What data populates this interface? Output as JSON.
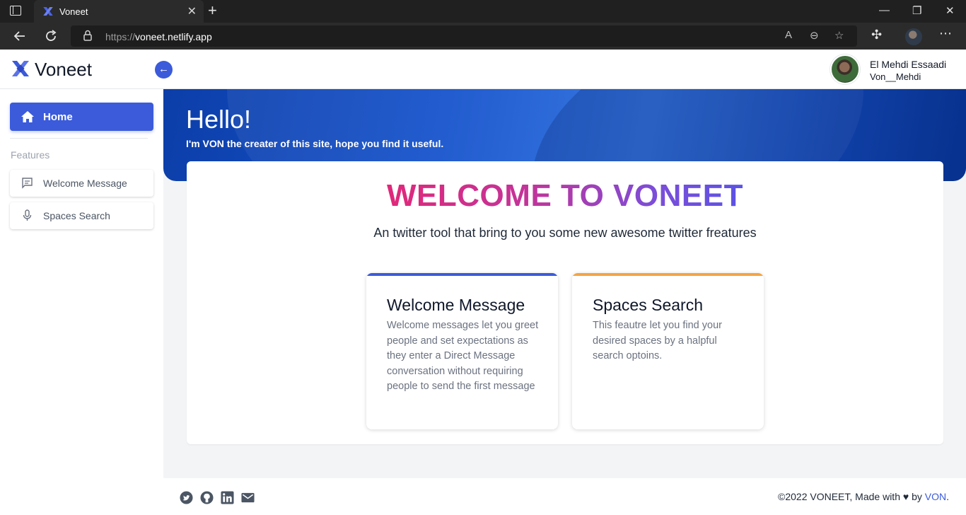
{
  "browser": {
    "tab_title": "Voneet",
    "tab_close": "✕",
    "new_tab": "+",
    "url_scheme": "https://",
    "url_host": "voneet.netlify.app",
    "window_controls": [
      "—",
      "❐",
      "✕"
    ]
  },
  "header": {
    "brand": "Voneet",
    "collapse_icon": "←",
    "user_name": "El Mehdi Essaadi",
    "user_handle": "Von__Mehdi"
  },
  "sidebar": {
    "home_label": "Home",
    "section_label": "Features",
    "items": [
      {
        "label": "Welcome Message",
        "icon": "message-icon"
      },
      {
        "label": "Spaces Search",
        "icon": "microphone-icon"
      }
    ]
  },
  "hero": {
    "title": "Hello!",
    "subtitle": "I'm VON the creater of this site, hope you find it useful."
  },
  "main": {
    "title": "WELCOME TO VONEET",
    "subtitle": "An twitter tool that bring to you some new awesome twitter freatures",
    "cards": [
      {
        "title": "Welcome Message",
        "description": "Welcome messages let you greet people and set expectations as they enter a Direct Message conversation without requiring people to send the first message",
        "accent": "#3b5bdb"
      },
      {
        "title": "Spaces Search",
        "description": "This feautre let you find your desired spaces by a halpful search optoins.",
        "accent": "#f5a442"
      }
    ]
  },
  "footer": {
    "social_icons": [
      "twitter-icon",
      "github-icon",
      "linkedin-icon",
      "mail-icon"
    ],
    "copyright_prefix": "©2022 VONEET, Made with",
    "heart": "♥",
    "by": "by",
    "author": "VON",
    "suffix": "."
  },
  "colors": {
    "primary": "#3b5bdb",
    "card_accent_orange": "#f5a442",
    "gradient_start": "#e0287a",
    "gradient_end": "#5b53e6"
  }
}
